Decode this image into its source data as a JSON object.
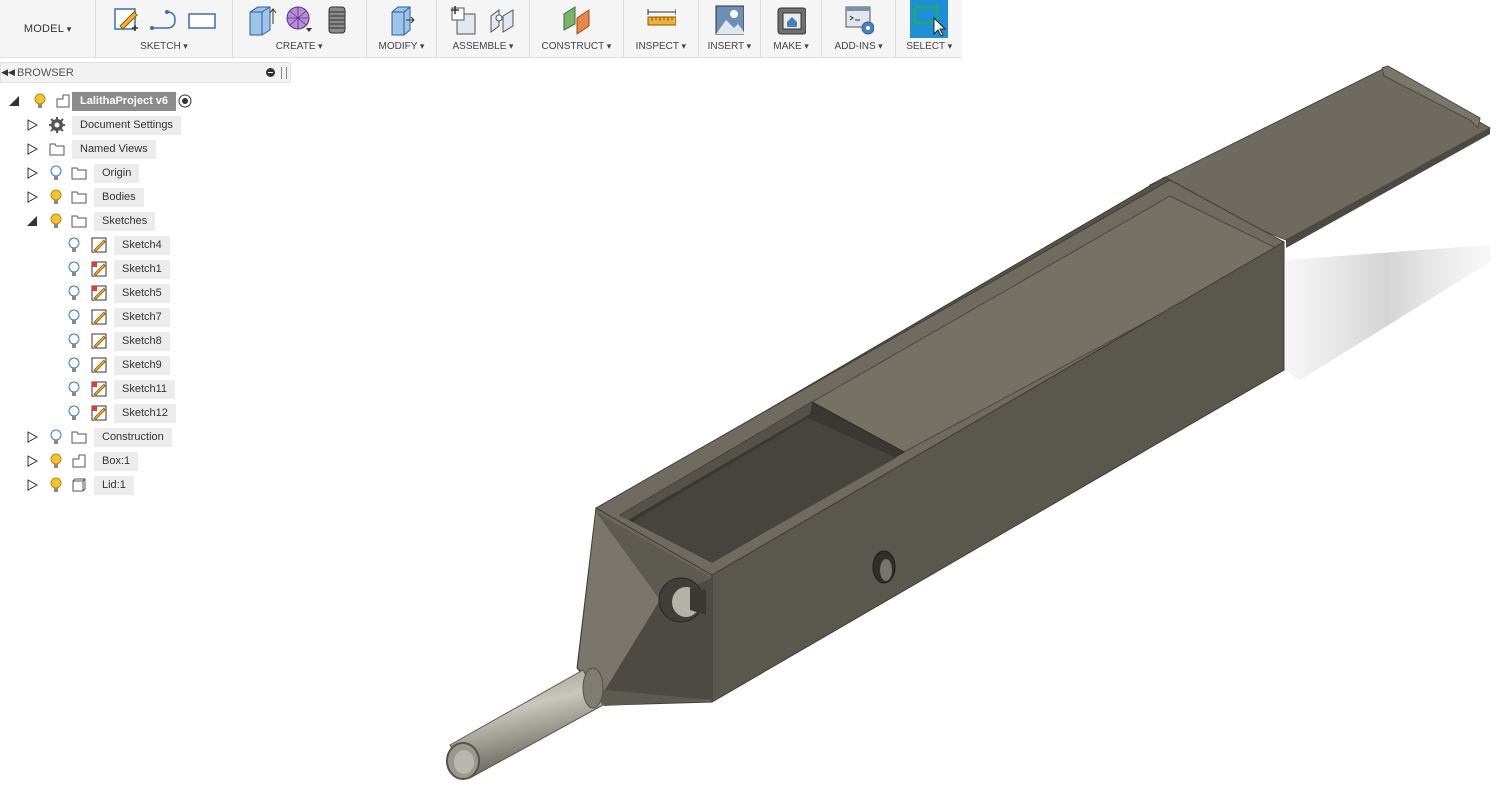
{
  "toolbar": {
    "workspace": "MODEL",
    "groups": [
      {
        "label": "SKETCH"
      },
      {
        "label": "CREATE"
      },
      {
        "label": "MODIFY"
      },
      {
        "label": "ASSEMBLE"
      },
      {
        "label": "CONSTRUCT"
      },
      {
        "label": "INSPECT"
      },
      {
        "label": "INSERT"
      },
      {
        "label": "MAKE"
      },
      {
        "label": "ADD-INS"
      },
      {
        "label": "SELECT"
      }
    ]
  },
  "browser": {
    "title": "BROWSER",
    "root": "LalithaProject v6",
    "items": [
      {
        "label": "Document Settings",
        "icon": "gear-icon"
      },
      {
        "label": "Named Views",
        "icon": "folder-icon"
      },
      {
        "label": "Origin",
        "icon": "folder-icon"
      },
      {
        "label": "Bodies",
        "icon": "folder-icon"
      },
      {
        "label": "Sketches",
        "icon": "folder-icon"
      },
      {
        "label": "Construction",
        "icon": "folder-icon"
      },
      {
        "label": "Box:1",
        "icon": "component-icon"
      },
      {
        "label": "Lid:1",
        "icon": "body-icon"
      }
    ],
    "sketches": [
      {
        "label": "Sketch4"
      },
      {
        "label": "Sketch1"
      },
      {
        "label": "Sketch5"
      },
      {
        "label": "Sketch7"
      },
      {
        "label": "Sketch8"
      },
      {
        "label": "Sketch9"
      },
      {
        "label": "Sketch11"
      },
      {
        "label": "Sketch12"
      }
    ]
  },
  "colors": {
    "model_body": "#5b584f",
    "model_top": "#6f6b60",
    "model_dark": "#3e3c36",
    "select_active": "#1e8fd6",
    "bulb_on": "#f4c430"
  }
}
